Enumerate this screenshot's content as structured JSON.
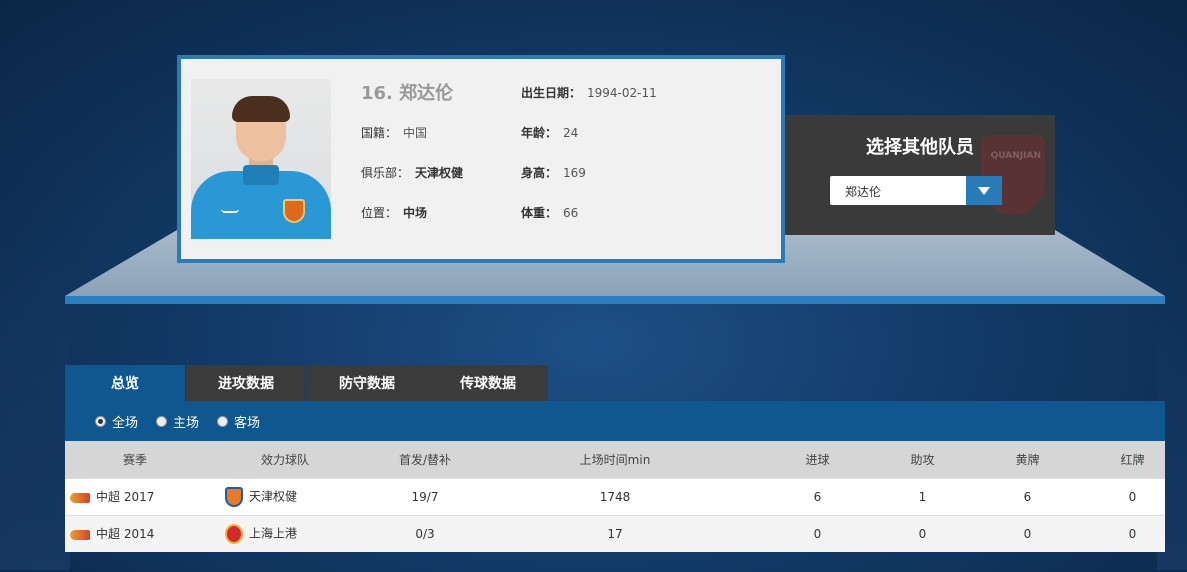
{
  "player": {
    "title": "16. 郑达伦",
    "fields": {
      "birth_label": "出生日期：",
      "birth_value": "1994-02-11",
      "nation_label": "国籍：",
      "nation_value": "中国",
      "age_label": "年龄：",
      "age_value": "24",
      "club_label": "俱乐部：",
      "club_value": "天津权健",
      "height_label": "身高：",
      "height_value": "169",
      "position_label": "位置：",
      "position_value": "中场",
      "weight_label": "体重：",
      "weight_value": "66"
    }
  },
  "select_panel": {
    "title": "选择其他队员",
    "selected": "郑达伦"
  },
  "tabs": [
    {
      "label": "总览",
      "active": true
    },
    {
      "label": "进攻数据",
      "active": false
    },
    {
      "label": "防守数据",
      "active": false
    },
    {
      "label": "传球数据",
      "active": false
    }
  ],
  "filters": [
    {
      "label": "全场",
      "checked": true
    },
    {
      "label": "主场",
      "checked": false
    },
    {
      "label": "客场",
      "checked": false
    }
  ],
  "table": {
    "headers": [
      "赛季",
      "效力球队",
      "首发/替补",
      "上场时间min",
      "进球",
      "助攻",
      "黄牌",
      "红牌"
    ],
    "rows": [
      {
        "season": "中超 2017",
        "team": "天津权健",
        "starts": "19/7",
        "minutes": "1748",
        "goals": "6",
        "assists": "1",
        "yellow": "6",
        "red": "0"
      },
      {
        "season": "中超 2014",
        "team": "上海上港",
        "starts": "0/3",
        "minutes": "17",
        "goals": "0",
        "assists": "0",
        "yellow": "0",
        "red": "0"
      }
    ]
  },
  "colors": {
    "accent_blue": "#11578f",
    "border_blue": "#2c7ab8",
    "tab_dark": "#3b3b3b"
  }
}
